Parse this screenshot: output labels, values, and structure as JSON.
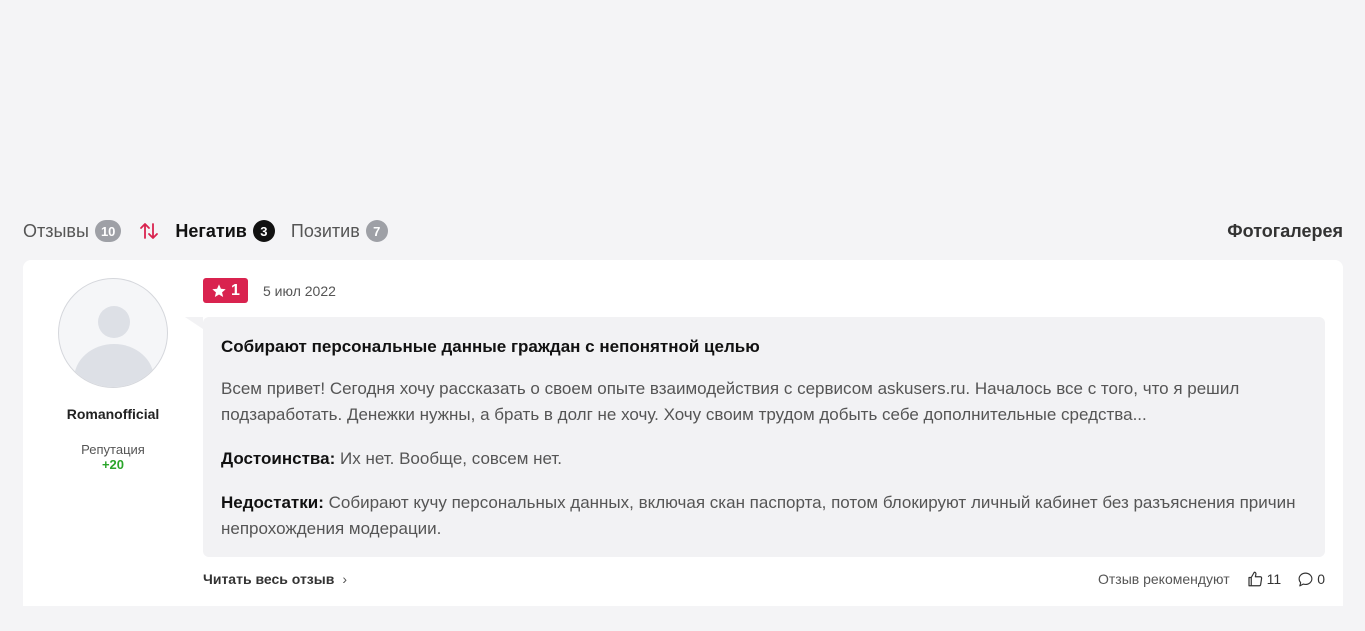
{
  "tabs": {
    "reviews": {
      "label": "Отзывы",
      "count": "10"
    },
    "negative": {
      "label": "Негатив",
      "count": "3"
    },
    "positive": {
      "label": "Позитив",
      "count": "7"
    },
    "gallery": "Фотогалерея"
  },
  "review": {
    "author": "Romanofficial",
    "reputation_label": "Репутация",
    "reputation_value": "+20",
    "rating": "1",
    "date": "5 июл 2022",
    "title": "Собирают персональные данные граждан с непонятной целью",
    "text": "Всем привет! Сегодня хочу рассказать о своем опыте взаимодействия с сервисом askusers.ru. Началось все с того, что я решил подзаработать. Денежки нужны, а брать в долг не хочу. Хочу своим трудом добыть себе дополнительные средства...",
    "pros_label": "Достоинства:",
    "pros": "Их нет. Вообще, совсем нет.",
    "cons_label": "Недостатки:",
    "cons": "Собирают кучу персональных данных, включая скан паспорта, потом блокируют личный кабинет без разъяснения причин непрохождения модерации.",
    "read_more": "Читать весь отзыв",
    "recommend": "Отзыв рекомендуют",
    "likes": "11",
    "comments": "0"
  },
  "colors": {
    "rating_bg": "#d9234f",
    "reputation": "#2aa52a",
    "badge": "#9ea0a6"
  },
  "icons": {
    "sort": "sort-arrows-icon",
    "star": "star-icon",
    "like": "thumbs-up-icon",
    "comment": "comment-icon",
    "chevron": "chevron-right-icon"
  }
}
